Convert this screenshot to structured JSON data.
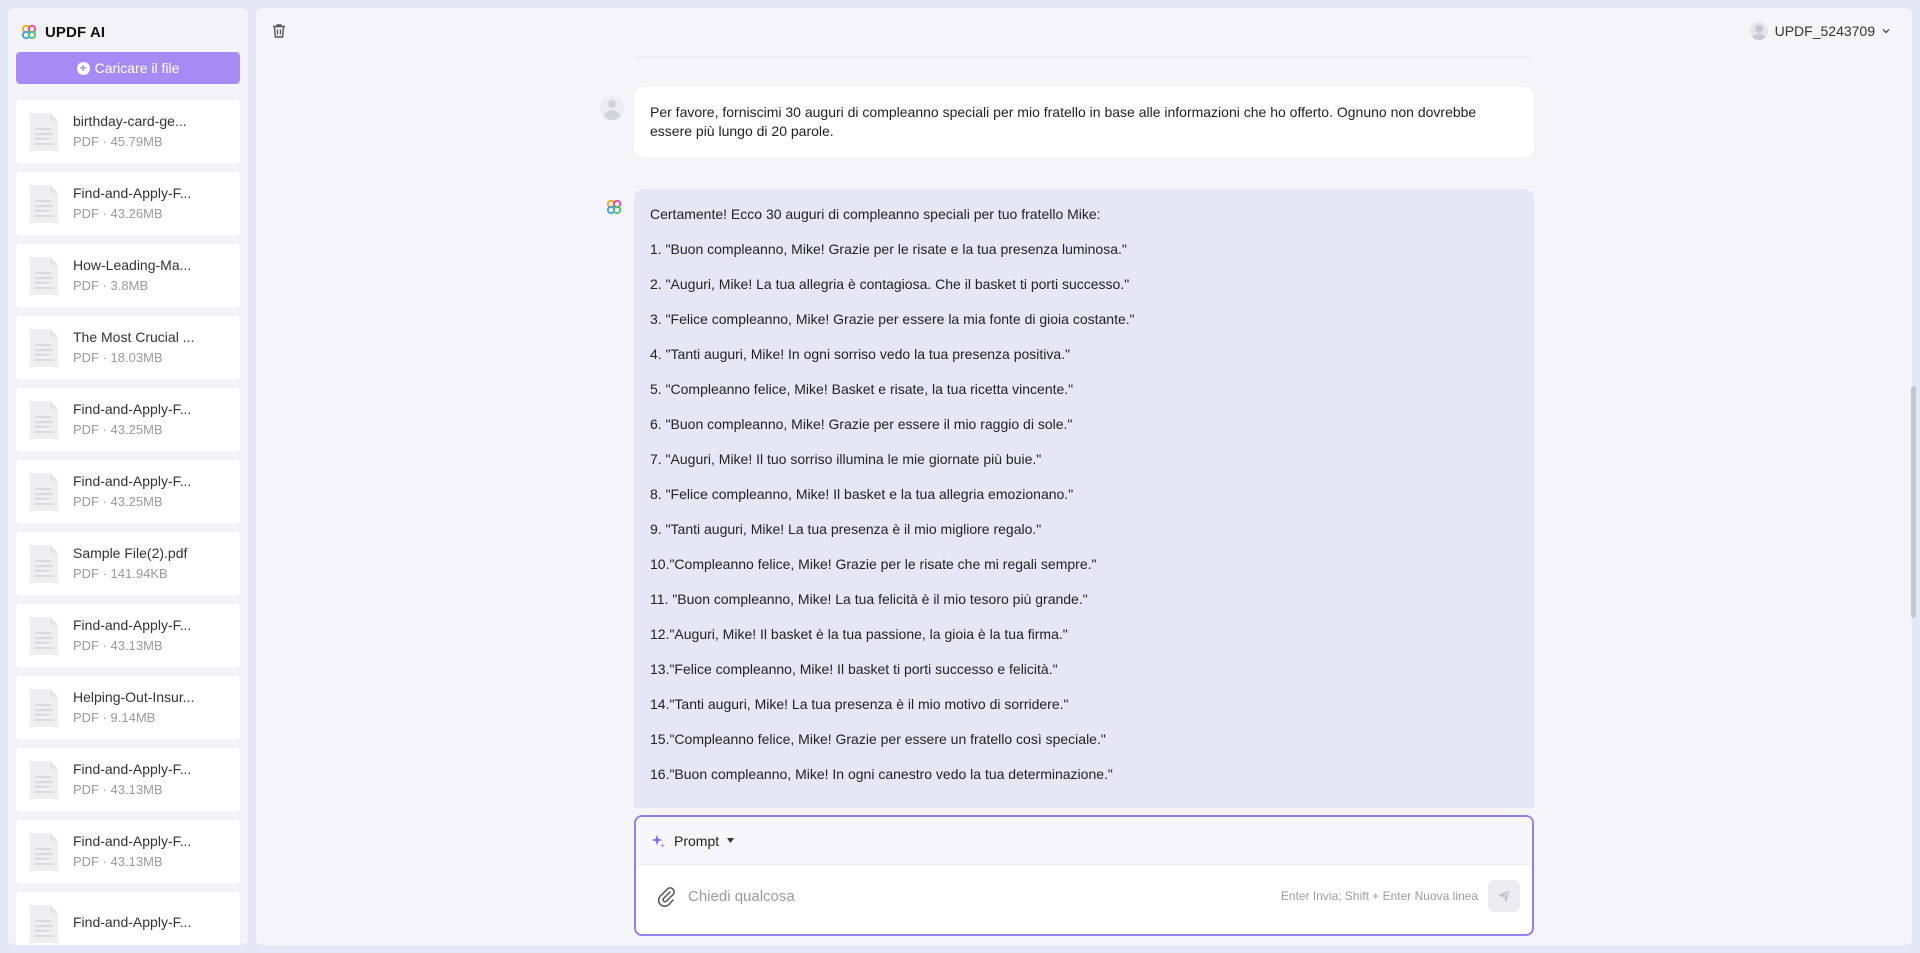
{
  "app": {
    "brand": "UPDF AI"
  },
  "sidebar": {
    "upload_label": "Caricare il file",
    "files": [
      {
        "name": "birthday-card-ge...",
        "info": "PDF · 45.79MB"
      },
      {
        "name": "Find-and-Apply-F...",
        "info": "PDF · 43.26MB"
      },
      {
        "name": "How-Leading-Ma...",
        "info": "PDF · 3.8MB"
      },
      {
        "name": "The Most Crucial ...",
        "info": "PDF · 18.03MB"
      },
      {
        "name": "Find-and-Apply-F...",
        "info": "PDF · 43.25MB"
      },
      {
        "name": "Find-and-Apply-F...",
        "info": "PDF · 43.25MB"
      },
      {
        "name": "Sample File(2).pdf",
        "info": "PDF · 141.94KB"
      },
      {
        "name": "Find-and-Apply-F...",
        "info": "PDF · 43.13MB"
      },
      {
        "name": "Helping-Out-Insur...",
        "info": "PDF · 9.14MB"
      },
      {
        "name": "Find-and-Apply-F...",
        "info": "PDF · 43.13MB"
      },
      {
        "name": "Find-and-Apply-F...",
        "info": "PDF · 43.13MB"
      },
      {
        "name": "Find-and-Apply-F...",
        "info": ""
      }
    ]
  },
  "header": {
    "username": "UPDF_5243709"
  },
  "chat": {
    "user_message": "Per favore, forniscimi 30 auguri di compleanno speciali per mio fratello in base alle informazioni che ho offerto. Ognuno non dovrebbe essere più lungo di 20 parole.",
    "ai_intro": "Certamente! Ecco 30 auguri di compleanno speciali per tuo fratello Mike:",
    "ai_items": [
      "1.  \"Buon compleanno, Mike! Grazie per le risate e la tua presenza luminosa.\"",
      "2.  \"Auguri, Mike! La tua allegria è contagiosa. Che il basket ti porti successo.\"",
      "3.  \"Felice compleanno, Mike! Grazie per essere la mia fonte di gioia costante.\"",
      "4.  \"Tanti auguri, Mike! In ogni sorriso vedo la tua presenza positiva.\"",
      "5.  \"Compleanno felice, Mike! Basket e risate, la tua ricetta vincente.\"",
      "6.  \"Buon compleanno, Mike! Grazie per essere il mio raggio di sole.\"",
      "7.  \"Auguri, Mike! Il tuo sorriso illumina le mie giornate più buie.\"",
      "8.  \"Felice compleanno, Mike! Il basket e la tua allegria emozionano.\"",
      "9.  \"Tanti auguri, Mike! La tua presenza è il mio migliore regalo.\"",
      "10.\"Compleanno felice, Mike! Grazie per le risate che mi regali sempre.\"",
      "11. \"Buon compleanno, Mike! La tua felicità è il mio tesoro più grande.\"",
      "12.\"Auguri, Mike! Il basket è la tua passione, la gioia è la tua firma.\"",
      "13.\"Felice compleanno, Mike! Il basket ti porti successo e felicità.\"",
      "14.\"Tanti auguri, Mike! La tua presenza è il mio motivo di sorridere.\"",
      "15.\"Compleanno felice, Mike! Grazie per essere un fratello così speciale.\"",
      "16.\"Buon compleanno, Mike! In ogni canestro vedo la tua determinazione.\""
    ]
  },
  "composer": {
    "prompt_label": "Prompt",
    "placeholder": "Chiedi qualcosa",
    "hint": "Enter Invia; Shift + Enter Nuova linea"
  },
  "colors": {
    "accent": "#a78bf4",
    "ai_bubble": "#e7e6f7",
    "composer_border": "#8f82ef"
  },
  "icons": [
    "updf-logo-icon",
    "upload-plus-icon",
    "pdf-document-icon",
    "trash-icon",
    "user-avatar-icon",
    "chevron-down-icon",
    "sparkle-icon",
    "caret-down-icon",
    "paperclip-icon",
    "send-icon"
  ]
}
